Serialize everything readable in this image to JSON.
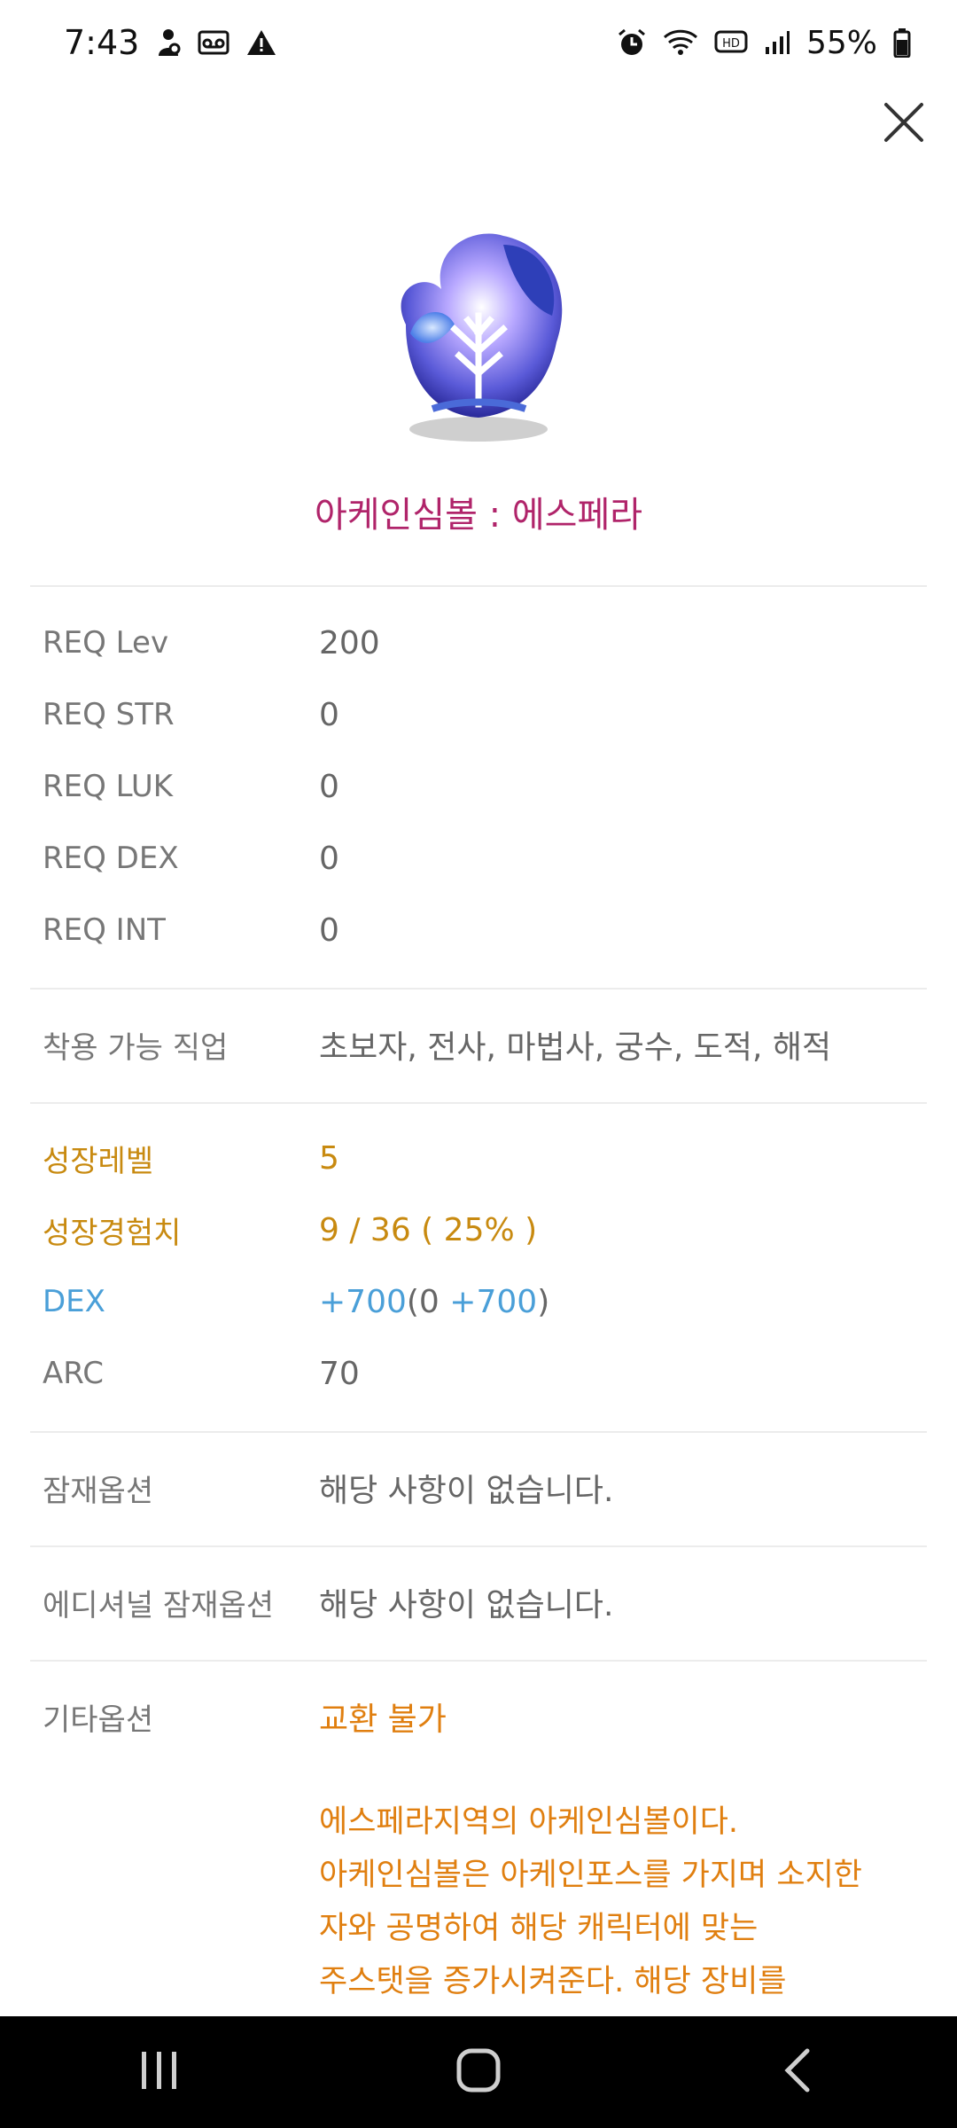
{
  "status_bar": {
    "time": "7:43",
    "battery": "55%",
    "left_icons": [
      "person-icon",
      "voicemail-icon",
      "warning-icon"
    ],
    "right_icons": [
      "alarm-icon",
      "wifi-icon",
      "hd-icon",
      "signal-icon",
      "battery-icon"
    ]
  },
  "dialog": {
    "close_icon": "close-icon",
    "item_name": "아케인심볼 : 에스페라",
    "requirements": [
      {
        "label": "REQ Lev",
        "value": "200"
      },
      {
        "label": "REQ STR",
        "value": "0"
      },
      {
        "label": "REQ LUK",
        "value": "0"
      },
      {
        "label": "REQ DEX",
        "value": "0"
      },
      {
        "label": "REQ INT",
        "value": "0"
      }
    ],
    "jobs": {
      "label": "착용 가능 직업",
      "value": "초보자, 전사, 마법사, 궁수, 도적, 해적"
    },
    "growth": {
      "level_label": "성장레벨",
      "level_value": "5",
      "exp_label": "성장경험치",
      "exp_value": "9 / 36 ( 25% )"
    },
    "dex": {
      "label": "DEX",
      "total": "+700",
      "open": "(0 ",
      "bonus": "+700",
      "close": ")"
    },
    "arc": {
      "label": "ARC",
      "value": "70"
    },
    "potential": {
      "label": "잠재옵션",
      "value": "해당 사항이 없습니다."
    },
    "additional_potential": {
      "label": "에디셔널 잠재옵션",
      "value": "해당 사항이 없습니다."
    },
    "etc": {
      "label": "기타옵션",
      "value": "교환 불가",
      "description_lines": [
        "에스페라지역의 아케인심볼이다.",
        "아케인심볼은 아케인포스를 가지며 소지한",
        "자와 공명하여 해당 캐릭터에 맞는",
        "주스탯을 증가시켜준다. 해당 장비를"
      ]
    }
  },
  "colors": {
    "item_name": "#b0246a",
    "growth": "#c88a10",
    "dex": "#4a9fd8",
    "etc": "#e07f10",
    "navbar": "#000000"
  },
  "navbar": {
    "icons": [
      "recents-icon",
      "home-icon",
      "back-icon"
    ]
  }
}
